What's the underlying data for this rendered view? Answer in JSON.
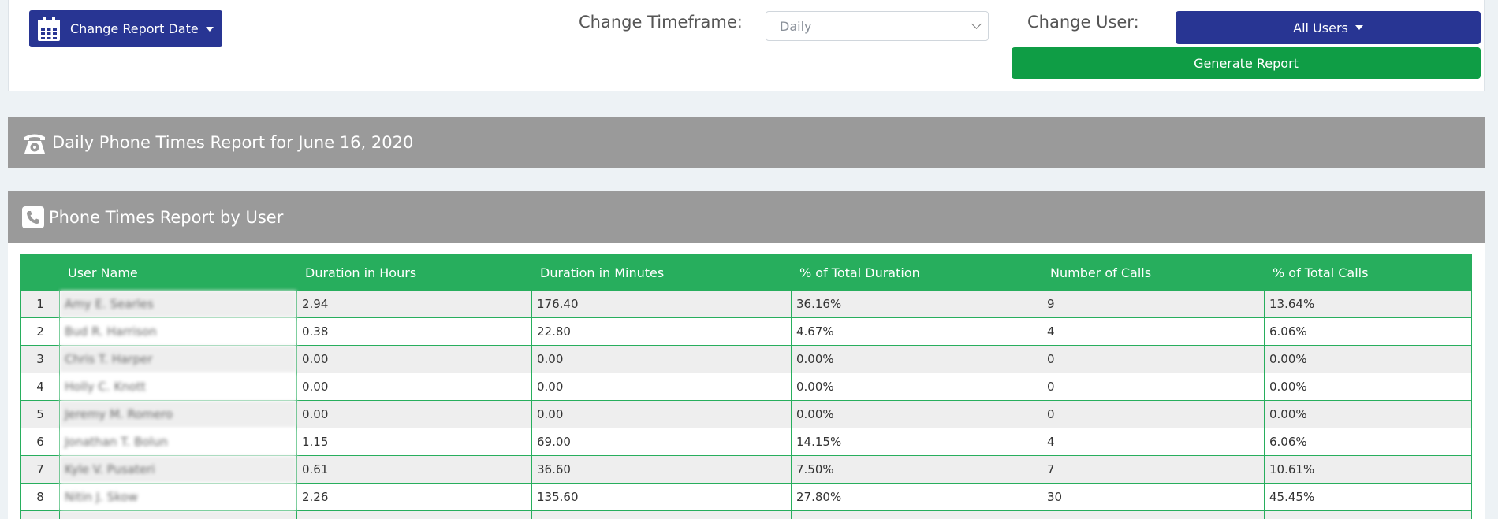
{
  "controls": {
    "report_date_label": "Change Report Date",
    "timeframe_label": "Change Timeframe:",
    "timeframe_value": "Daily",
    "user_label": "Change User:",
    "user_value": "All Users",
    "generate_label": "Generate Report"
  },
  "header_bar": {
    "title": "Daily Phone Times Report for June 16, 2020"
  },
  "report": {
    "title": "Phone Times Report by User",
    "columns": [
      "",
      "User Name",
      "Duration in Hours",
      "Duration in Minutes",
      "% of Total Duration",
      "Number of Calls",
      "% of Total Calls"
    ],
    "rows": [
      {
        "n": "1",
        "name": "Amy E. Searles",
        "hours": "2.94",
        "minutes": "176.40",
        "pct_dur": "36.16%",
        "calls": "9",
        "pct_calls": "13.64%"
      },
      {
        "n": "2",
        "name": "Bud R. Harrison",
        "hours": "0.38",
        "minutes": "22.80",
        "pct_dur": "4.67%",
        "calls": "4",
        "pct_calls": "6.06%"
      },
      {
        "n": "3",
        "name": "Chris T. Harper",
        "hours": "0.00",
        "minutes": "0.00",
        "pct_dur": "0.00%",
        "calls": "0",
        "pct_calls": "0.00%"
      },
      {
        "n": "4",
        "name": "Holly C. Knott",
        "hours": "0.00",
        "minutes": "0.00",
        "pct_dur": "0.00%",
        "calls": "0",
        "pct_calls": "0.00%"
      },
      {
        "n": "5",
        "name": "Jeremy M. Romero",
        "hours": "0.00",
        "minutes": "0.00",
        "pct_dur": "0.00%",
        "calls": "0",
        "pct_calls": "0.00%"
      },
      {
        "n": "6",
        "name": "Jonathan T. Bolun",
        "hours": "1.15",
        "minutes": "69.00",
        "pct_dur": "14.15%",
        "calls": "4",
        "pct_calls": "6.06%"
      },
      {
        "n": "7",
        "name": "Kyle V. Pusateri",
        "hours": "0.61",
        "minutes": "36.60",
        "pct_dur": "7.50%",
        "calls": "7",
        "pct_calls": "10.61%"
      },
      {
        "n": "8",
        "name": "Nitin J. Skow",
        "hours": "2.26",
        "minutes": "135.60",
        "pct_dur": "27.80%",
        "calls": "30",
        "pct_calls": "45.45%"
      }
    ]
  },
  "colors": {
    "primary_blue": "#283593",
    "generate_green": "#0f9d45",
    "table_header_green": "#27ae5d",
    "section_bar_gray": "#9a9a9a"
  },
  "icons": [
    "calendar-icon",
    "caret-down-icon",
    "chevron-down-icon",
    "rotary-phone-icon",
    "phone-square-icon"
  ]
}
